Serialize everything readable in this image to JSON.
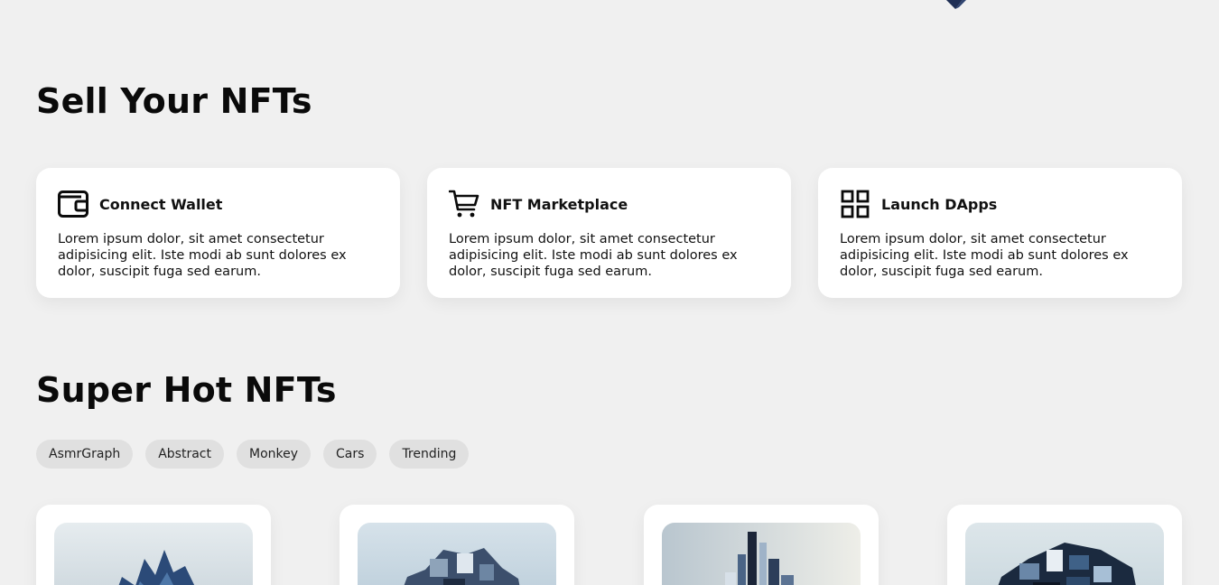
{
  "sections": {
    "sell_title": "Sell Your NFTs",
    "hot_title": "Super Hot NFTs"
  },
  "features": [
    {
      "icon": "wallet-icon",
      "title": "Connect Wallet",
      "description": "Lorem ipsum dolor, sit amet consectetur adipisicing elit. Iste modi ab sunt dolores ex dolor, suscipit fuga sed earum."
    },
    {
      "icon": "cart-icon",
      "title": "NFT Marketplace",
      "description": "Lorem ipsum dolor, sit amet consectetur adipisicing elit. Iste modi ab sunt dolores ex dolor, suscipit fuga sed earum."
    },
    {
      "icon": "grid-icon",
      "title": "Launch DApps",
      "description": "Lorem ipsum dolor, sit amet consectetur adipisicing elit. Iste modi ab sunt dolores ex dolor, suscipit fuga sed earum."
    }
  ],
  "tags": [
    "AsmrGraph",
    "Abstract",
    "Monkey",
    "Cars",
    "Trending"
  ],
  "colors": {
    "background": "#f0f0f0",
    "card": "#ffffff",
    "tag_bg": "#e0e0e0",
    "text": "#0b0b0b",
    "accent_navy": "#1f2f55"
  }
}
